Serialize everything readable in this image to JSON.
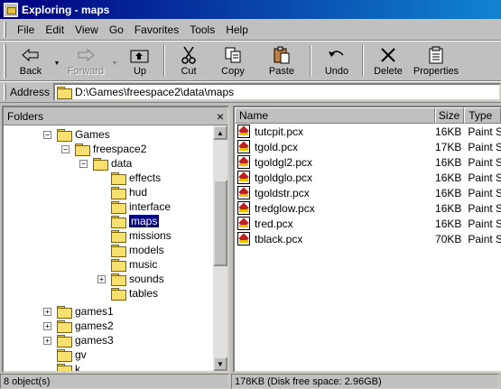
{
  "window": {
    "title": "Exploring - maps"
  },
  "menu": [
    "File",
    "Edit",
    "View",
    "Go",
    "Favorites",
    "Tools",
    "Help"
  ],
  "toolbar": {
    "back": "Back",
    "forward": "Forward",
    "up": "Up",
    "cut": "Cut",
    "copy": "Copy",
    "paste": "Paste",
    "undo": "Undo",
    "delete": "Delete",
    "properties": "Properties"
  },
  "address": {
    "label": "Address",
    "path": "D:\\Games\\freespace2\\data\\maps"
  },
  "folders": {
    "header": "Folders",
    "close": "×",
    "tree": [
      "Games",
      "freespace2",
      "data",
      "effects",
      "hud",
      "interface",
      "maps",
      "missions",
      "models",
      "music",
      "sounds",
      "tables",
      "games1",
      "games2",
      "games3",
      "gv",
      "k"
    ]
  },
  "files": {
    "columns": [
      "Name",
      "Size",
      "Type"
    ],
    "rows": [
      {
        "name": "tutcpit.pcx",
        "size": "16KB",
        "type": "Paint S"
      },
      {
        "name": "tgold.pcx",
        "size": "17KB",
        "type": "Paint S"
      },
      {
        "name": "tgoldgl2.pcx",
        "size": "16KB",
        "type": "Paint S"
      },
      {
        "name": "tgoldglo.pcx",
        "size": "16KB",
        "type": "Paint S"
      },
      {
        "name": "tgoldstr.pcx",
        "size": "16KB",
        "type": "Paint S"
      },
      {
        "name": "tredglow.pcx",
        "size": "16KB",
        "type": "Paint S"
      },
      {
        "name": "tred.pcx",
        "size": "16KB",
        "type": "Paint S"
      },
      {
        "name": "tblack.pcx",
        "size": "70KB",
        "type": "Paint S"
      }
    ]
  },
  "status": {
    "objects": "8 object(s)",
    "disk": "178KB (Disk free space: 2.96GB)"
  }
}
